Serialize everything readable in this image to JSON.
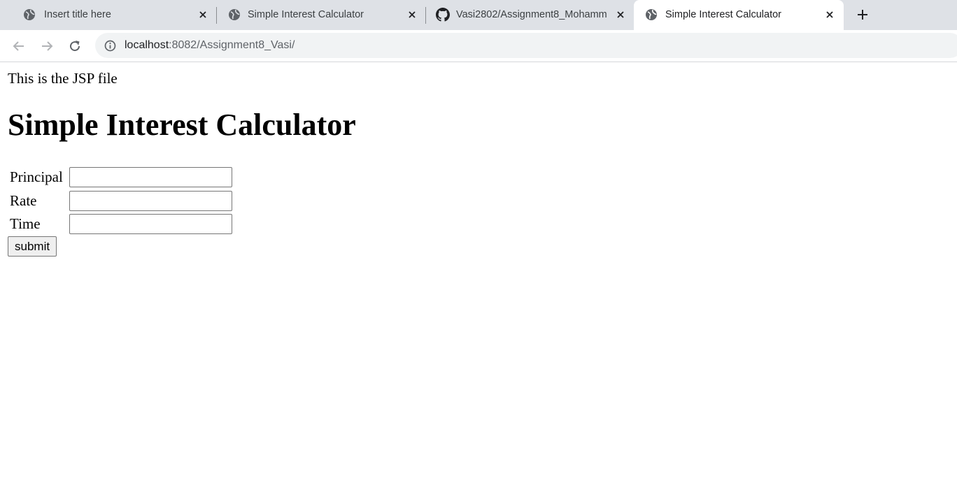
{
  "browser": {
    "tabs": [
      {
        "title": "Insert title here",
        "icon": "globe-icon",
        "active": false
      },
      {
        "title": "Simple Interest Calculator",
        "icon": "globe-icon",
        "active": false
      },
      {
        "title": "Vasi2802/Assignment8_Mohamm",
        "icon": "github-icon",
        "active": false
      },
      {
        "title": "Simple Interest Calculator",
        "icon": "globe-icon",
        "active": true
      }
    ],
    "url_host": "localhost",
    "url_path": ":8082/Assignment8_Vasi/"
  },
  "page": {
    "intro_text": "This is the JSP file",
    "heading": "Simple Interest Calculator",
    "form": {
      "principal_label": "Principal",
      "principal_value": "",
      "rate_label": "Rate",
      "rate_value": "",
      "time_label": "Time",
      "time_value": "",
      "submit_label": "submit"
    }
  }
}
